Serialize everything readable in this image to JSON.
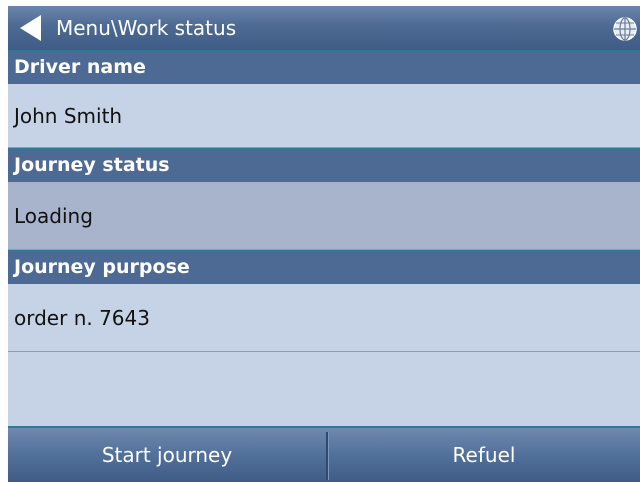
{
  "header": {
    "title": "Menu\\Work status",
    "back_icon": "back-arrow-icon",
    "globe_icon": "globe-icon"
  },
  "sections": {
    "driver": {
      "label": "Driver name",
      "value": "John Smith"
    },
    "status": {
      "label": "Journey status",
      "value": "Loading"
    },
    "purpose": {
      "label": "Journey purpose",
      "value": "order n. 7643"
    }
  },
  "footer": {
    "start_label": "Start journey",
    "refuel_label": "Refuel"
  },
  "colors": {
    "header_bg": "#4d6a94",
    "field_bg": "#c6d2e6",
    "selected_bg": "#a7b4cc",
    "accent_line": "#2b7b96"
  }
}
